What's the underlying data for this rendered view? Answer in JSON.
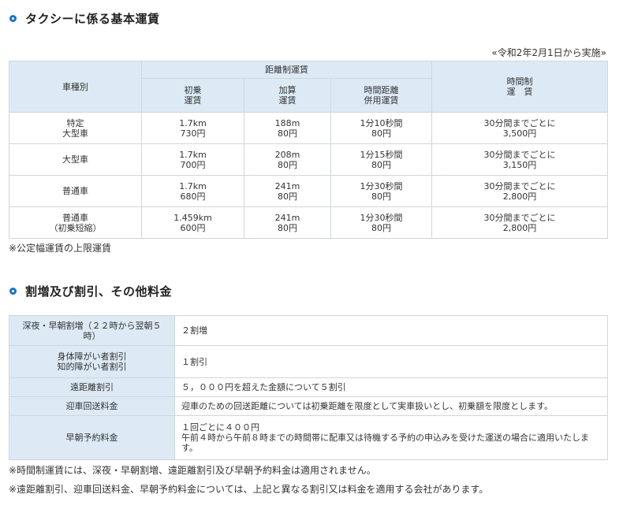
{
  "section1": {
    "title": "タクシーに係る基本運賃"
  },
  "effective_date": "«令和2年2月1日から実施»",
  "fare_table": {
    "header": {
      "vehicle_type": "車種別",
      "distance_fare": "距離制運賃",
      "initial": [
        "初乗",
        "運賃"
      ],
      "added": [
        "加算",
        "運賃"
      ],
      "time_distance": [
        "時間距離",
        "併用運賃"
      ],
      "time_fare": [
        "時間制",
        "運　賃"
      ]
    },
    "rows": [
      {
        "type": [
          "特定",
          "大型車"
        ],
        "initial": [
          "1.7km",
          "730円"
        ],
        "added": [
          "188m",
          "80円"
        ],
        "time_distance": [
          "1分10秒間",
          "80円"
        ],
        "time_fare": [
          "30分間までごとに",
          "3,500円"
        ]
      },
      {
        "type": [
          "大型車"
        ],
        "initial": [
          "1.7km",
          "700円"
        ],
        "added": [
          "208m",
          "80円"
        ],
        "time_distance": [
          "1分15秒間",
          "80円"
        ],
        "time_fare": [
          "30分間までごとに",
          "3,150円"
        ]
      },
      {
        "type": [
          "普通車"
        ],
        "initial": [
          "1.7km",
          "680円"
        ],
        "added": [
          "241m",
          "80円"
        ],
        "time_distance": [
          "1分30秒間",
          "80円"
        ],
        "time_fare": [
          "30分間までごとに",
          "2,800円"
        ]
      },
      {
        "type": [
          "普通車",
          "（初乗短縮）"
        ],
        "initial": [
          "1.459km",
          "600円"
        ],
        "added": [
          "241m",
          "80円"
        ],
        "time_distance": [
          "1分30秒間",
          "80円"
        ],
        "time_fare": [
          "30分間までごとに",
          "2,800円"
        ]
      }
    ]
  },
  "note1": "※公定幅運賃の上限運賃",
  "section2": {
    "title": "割増及び割引、その他料金"
  },
  "other_table": [
    {
      "label": [
        "深夜・早朝割増（２２時から翌朝５",
        "時）"
      ],
      "value": [
        "２割増"
      ]
    },
    {
      "label": [
        "身体障がい者割引",
        "知的障がい者割引"
      ],
      "value": [
        "１割引"
      ]
    },
    {
      "label": [
        "遠距離割引"
      ],
      "value": [
        "５，０００円を超えた金額について５割引"
      ]
    },
    {
      "label": [
        "迎車回送料金"
      ],
      "value": [
        "迎車のための回送距離については初乗距離を限度として実車扱いとし、初乗額を限度とします。"
      ]
    },
    {
      "label": [
        "早朝予約料金"
      ],
      "value": [
        "１回ごとに４００円",
        "午前４時から午前８時までの時間帯に配車又は待機する予約の申込みを受けた運送の場合に適用いたしま",
        "す。"
      ]
    }
  ],
  "note2": "※時間制運賃には、深夜・早朝割増、遠距離割引及び早朝予約料金は適用されません。",
  "note3": "※遠距離割引、迎車回送料金、早朝予約料金については、上記と異なる割引又は料金を適用する会社があります。",
  "colors": {
    "accent": "#1a73c8",
    "header_bg": "#ddeaf5",
    "border": "#cfd6dc"
  }
}
